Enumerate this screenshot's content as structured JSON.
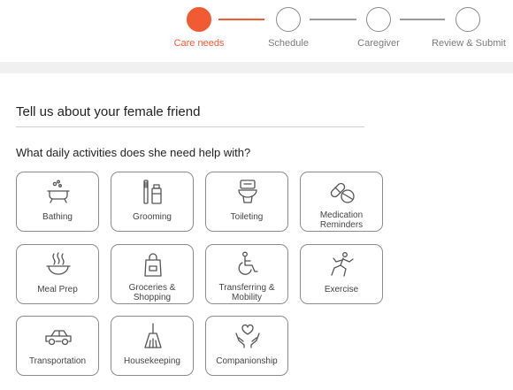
{
  "stepper": {
    "steps": [
      {
        "label": "Care needs",
        "active": true
      },
      {
        "label": "Schedule",
        "active": false
      },
      {
        "label": "Caregiver",
        "active": false
      },
      {
        "label": "Review & Submit",
        "active": false
      }
    ]
  },
  "form": {
    "heading": "Tell us about your female friend",
    "question": "What daily activities does she need help with?",
    "activities": [
      {
        "label": "Bathing",
        "icon": "bathtub-icon"
      },
      {
        "label": "Grooming",
        "icon": "toothbrush-icon"
      },
      {
        "label": "Toileting",
        "icon": "toilet-icon"
      },
      {
        "label": "Medication\nReminders",
        "icon": "pills-icon"
      },
      {
        "label": "Meal Prep",
        "icon": "steaming-bowl-icon"
      },
      {
        "label": "Groceries &\nShopping",
        "icon": "shopping-bag-icon"
      },
      {
        "label": "Transferring &\nMobility",
        "icon": "wheelchair-icon"
      },
      {
        "label": "Exercise",
        "icon": "exercise-icon"
      },
      {
        "label": "Transportation",
        "icon": "car-icon"
      },
      {
        "label": "Housekeeping",
        "icon": "broom-icon"
      },
      {
        "label": "Companionship",
        "icon": "heart-hands-icon"
      }
    ]
  },
  "colors": {
    "accent": "#f25a34",
    "border": "#8c8c8c",
    "band": "#f0f0f0"
  }
}
